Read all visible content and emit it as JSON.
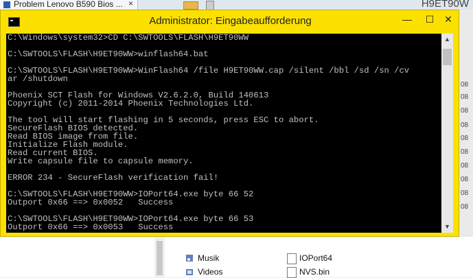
{
  "browser_tab": {
    "title": "Problem Lenovo B590 Bios ...",
    "close": "×"
  },
  "corner_text": "H9ET90W",
  "window": {
    "title": "Administrator: Eingabeaufforderung",
    "minimize": "—",
    "maximize": "☐",
    "close": "✕",
    "scroll_up": "▲",
    "scroll_down": "▼"
  },
  "console": {
    "lines": [
      "C:\\Windows\\system32>CD C:\\SWTOOLS\\FLASH\\H9ET90WW",
      "",
      "C:\\SWTOOLS\\FLASH\\H9ET90WW>winflash64.bat",
      "",
      "C:\\SWTOOLS\\FLASH\\H9ET90WW>WinFlash64 /file H9ET90WW.cap /silent /bbl /sd /sn /cv",
      "ar /shutdown",
      "",
      "Phoenix SCT Flash for Windows V2.6.2.0, Build 140613",
      "Copyright (c) 2011-2014 Phoenix Technologies Ltd.",
      "",
      "The tool will start flashing in 5 seconds, press ESC to abort.",
      "SecureFlash BIOS detected.",
      "Read BIOS image from file.",
      "Initialize Flash module.",
      "Read current BIOS.",
      "Write capsule file to capsule memory.",
      "",
      "ERROR 234 - SecureFlash verification fail!",
      "",
      "C:\\SWTOOLS\\FLASH\\H9ET90WW>IOPort64.exe byte 66 52",
      "Outport 0x66 ==> 0x0052   Success",
      "",
      "C:\\SWTOOLS\\FLASH\\H9ET90WW>IOPort64.exe byte 66 53",
      "Outport 0x66 ==> 0x0053   Success"
    ]
  },
  "explorer": {
    "nav_items": [
      "Musik",
      "Videos"
    ],
    "files": [
      "IOPort64",
      "NVS.bin"
    ],
    "right_numbers": [
      "08",
      "08",
      "08",
      "08",
      "08",
      "08",
      "08",
      "08",
      "08",
      "08"
    ]
  }
}
